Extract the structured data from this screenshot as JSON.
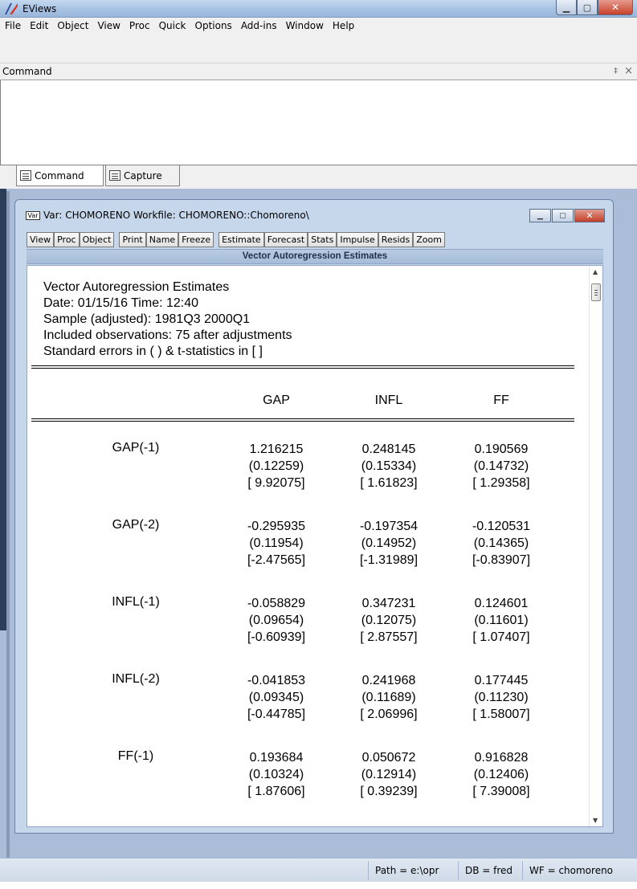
{
  "app": {
    "title": "EViews",
    "min_glyph": "▁",
    "max_glyph": "▢",
    "close_glyph": "✕"
  },
  "menu": [
    "File",
    "Edit",
    "Object",
    "View",
    "Proc",
    "Quick",
    "Options",
    "Add-ins",
    "Window",
    "Help"
  ],
  "command_pane": {
    "title": "Command",
    "pin_glyph": "‡",
    "close_glyph": "×",
    "tabs": [
      {
        "label": "Command",
        "icon": "text-doc-icon"
      },
      {
        "label": "Capture",
        "icon": "text-doc-icon"
      }
    ]
  },
  "var_window": {
    "icon_text": "Var",
    "title": "Var: CHOMORENO   Workfile: CHOMORENO::Chomoreno\\",
    "toolbar": [
      {
        "group": [
          "View",
          "Proc",
          "Object"
        ]
      },
      {
        "group": [
          "Print",
          "Name",
          "Freeze"
        ]
      },
      {
        "group": [
          "Estimate",
          "Forecast",
          "Stats",
          "Impulse",
          "Resids",
          "Zoom"
        ]
      }
    ],
    "header": "Vector Autoregression Estimates",
    "output": {
      "lines": [
        "Vector Autoregression Estimates",
        "Date: 01/15/16   Time: 12:40",
        "Sample (adjusted): 1981Q3 2000Q1",
        "Included observations: 75 after adjustments",
        "Standard errors in ( ) & t-statistics in [ ]"
      ],
      "columns": [
        "GAP",
        "INFL",
        "FF"
      ],
      "rows": [
        {
          "label": "GAP(-1)",
          "coef": [
            "1.216215",
            "0.248145",
            "0.190569"
          ],
          "se": [
            "(0.12259)",
            "(0.15334)",
            "(0.14732)"
          ],
          "t": [
            "[ 9.92075]",
            "[ 1.61823]",
            "[ 1.29358]"
          ]
        },
        {
          "label": "GAP(-2)",
          "coef": [
            "-0.295935",
            "-0.197354",
            "-0.120531"
          ],
          "se": [
            "(0.11954)",
            "(0.14952)",
            "(0.14365)"
          ],
          "t": [
            "[-2.47565]",
            "[-1.31989]",
            "[-0.83907]"
          ]
        },
        {
          "label": "INFL(-1)",
          "coef": [
            "-0.058829",
            "0.347231",
            "0.124601"
          ],
          "se": [
            "(0.09654)",
            "(0.12075)",
            "(0.11601)"
          ],
          "t": [
            "[-0.60939]",
            "[ 2.87557]",
            "[ 1.07407]"
          ]
        },
        {
          "label": "INFL(-2)",
          "coef": [
            "-0.041853",
            "0.241968",
            "0.177445"
          ],
          "se": [
            "(0.09345)",
            "(0.11689)",
            "(0.11230)"
          ],
          "t": [
            "[-0.44785]",
            "[ 2.06996]",
            "[ 1.58007]"
          ]
        },
        {
          "label": "FF(-1)",
          "coef": [
            "0.193684",
            "0.050672",
            "0.916828"
          ],
          "se": [
            "(0.10324)",
            "(0.12914)",
            "(0.12406)"
          ],
          "t": [
            "[ 1.87606]",
            "[ 0.39239]",
            "[ 7.39008]"
          ]
        }
      ]
    },
    "scroll": {
      "up": "▲",
      "down": "▼"
    }
  },
  "status": {
    "path": "Path = e:\\opr",
    "db": "DB = fred",
    "wf": "WF = chomoreno"
  },
  "colors": {
    "workspace": "#aabcd7",
    "window_frame": "#c6d7ec",
    "title_gradient": "#a9c4e4"
  }
}
